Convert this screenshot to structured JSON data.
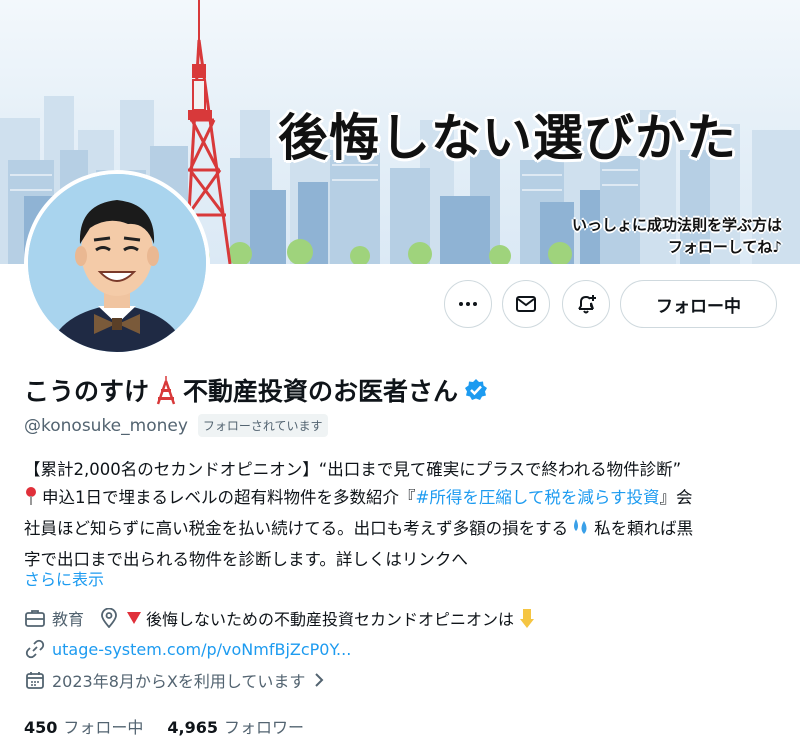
{
  "banner": {
    "title": "後悔しない選びかた",
    "subtitle_line1": "いっしょに成功法則を学ぶ方は",
    "subtitle_line2": "フォローしてね♪"
  },
  "actions": {
    "more_icon": "more-horizontal-icon",
    "message_icon": "mail-icon",
    "notify_icon": "bell-plus-icon",
    "follow_label": "フォロー中"
  },
  "profile": {
    "name_part1": "こうのすけ",
    "name_emoji": "tokyo-tower-icon",
    "name_part2": "不動産投資のお医者さん",
    "verified_icon": "verified-badge-icon",
    "handle": "@konosuke_money",
    "follows_you": "フォローされています",
    "bio_line1": "【累計2,000名のセカンドオピニオン】“出口まで見て確実にプラスで終われる物件診断”",
    "bio_line2_a": "申込1日で埋まるレベルの超有料物件を多数紹介『",
    "bio_hashtag": "#所得を圧縮して税を減らす投資",
    "bio_line2_b": "』会",
    "bio_line3_a": "社員ほど知らずに高い税金を払い続けてる。出口も考えず多額の損をする",
    "bio_line3_b": "私を頼れば黒",
    "bio_line4": "字で出口まで出られる物件を診断します。詳しくはリンクへ",
    "show_more": "さらに表示"
  },
  "meta": {
    "category": "教育",
    "location": "後悔しないための不動産投資セカンドオピニオンは",
    "link": "utage-system.com/p/voNmfBjZcP0Y...",
    "joined": "2023年8月からXを利用しています"
  },
  "counts": {
    "following_count": "450",
    "following_label": "フォロー中",
    "followers_count": "4,965",
    "followers_label": "フォロワー"
  },
  "colors": {
    "accent": "#1d9bf0",
    "secondary_text": "#536471",
    "border": "#cfd9de"
  }
}
